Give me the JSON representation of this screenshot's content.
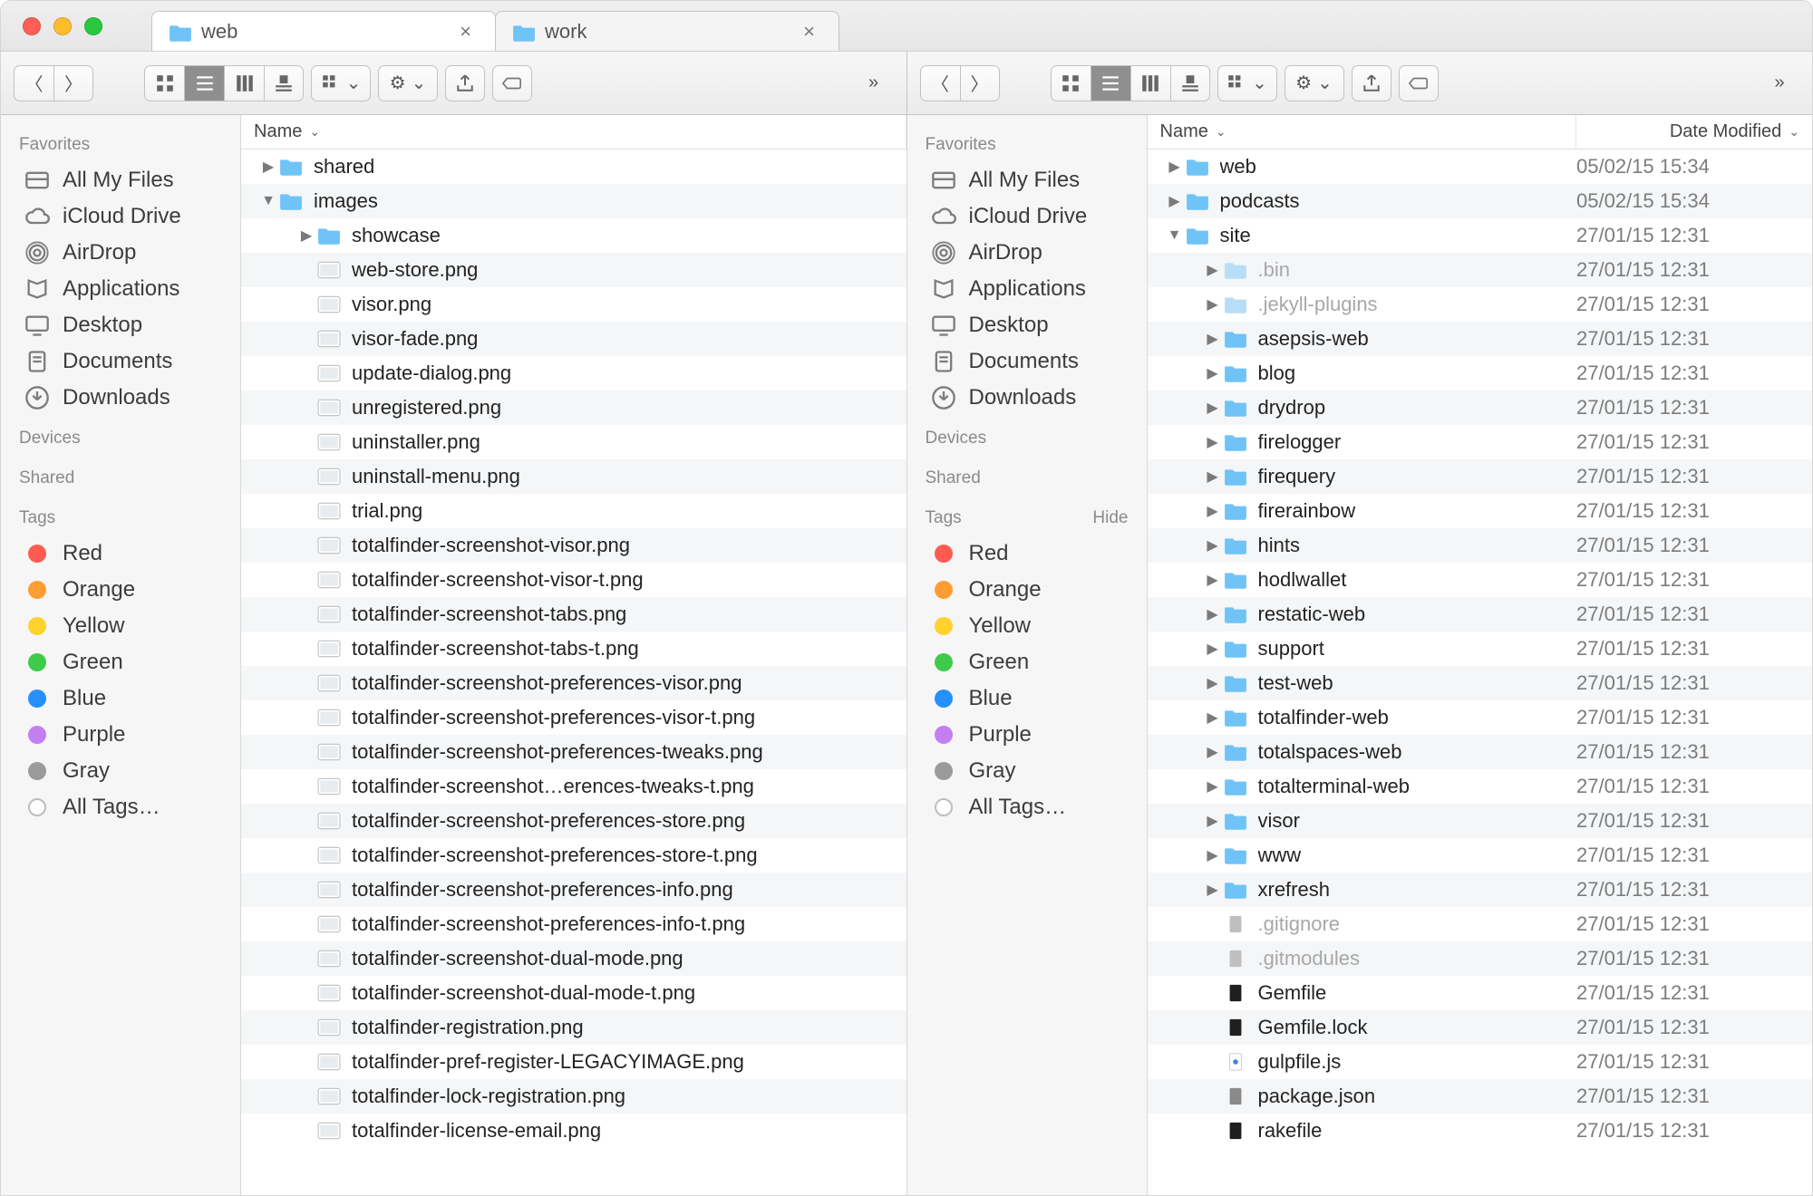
{
  "tabs": [
    {
      "title": "web",
      "active": true
    },
    {
      "title": "work",
      "active": false
    }
  ],
  "columns": {
    "name": "Name",
    "date": "Date Modified"
  },
  "sidebar": {
    "sections": [
      {
        "title": "Favorites",
        "items": [
          {
            "icon": "allmyfiles",
            "label": "All My Files"
          },
          {
            "icon": "cloud",
            "label": "iCloud Drive"
          },
          {
            "icon": "airdrop",
            "label": "AirDrop"
          },
          {
            "icon": "apps",
            "label": "Applications"
          },
          {
            "icon": "desktop",
            "label": "Desktop"
          },
          {
            "icon": "docs",
            "label": "Documents"
          },
          {
            "icon": "downloads",
            "label": "Downloads"
          }
        ]
      },
      {
        "title": "Devices",
        "items": []
      },
      {
        "title": "Shared",
        "items": []
      },
      {
        "title": "Tags",
        "hide_visible_on_right": true,
        "items": [
          {
            "icon": "tag",
            "color": "#ff5b52",
            "label": "Red"
          },
          {
            "icon": "tag",
            "color": "#ff9d32",
            "label": "Orange"
          },
          {
            "icon": "tag",
            "color": "#ffd22e",
            "label": "Yellow"
          },
          {
            "icon": "tag",
            "color": "#3ecb4b",
            "label": "Green"
          },
          {
            "icon": "tag",
            "color": "#2690ff",
            "label": "Blue"
          },
          {
            "icon": "tag",
            "color": "#c37ff2",
            "label": "Purple"
          },
          {
            "icon": "tag",
            "color": "#9b9b9b",
            "label": "Gray"
          },
          {
            "icon": "tag",
            "color": "",
            "label": "All Tags…"
          }
        ]
      }
    ],
    "hide_label": "Hide"
  },
  "left": {
    "has_date": false,
    "rows": [
      {
        "depth": 0,
        "disclose": "right",
        "kind": "folder",
        "name": "shared"
      },
      {
        "depth": 0,
        "disclose": "down",
        "kind": "folder",
        "name": "images"
      },
      {
        "depth": 1,
        "disclose": "right",
        "kind": "folder",
        "name": "showcase"
      },
      {
        "depth": 1,
        "disclose": "",
        "kind": "png",
        "name": "web-store.png"
      },
      {
        "depth": 1,
        "disclose": "",
        "kind": "png",
        "name": "visor.png"
      },
      {
        "depth": 1,
        "disclose": "",
        "kind": "png",
        "name": "visor-fade.png"
      },
      {
        "depth": 1,
        "disclose": "",
        "kind": "png",
        "name": "update-dialog.png"
      },
      {
        "depth": 1,
        "disclose": "",
        "kind": "png",
        "name": "unregistered.png"
      },
      {
        "depth": 1,
        "disclose": "",
        "kind": "png",
        "name": "uninstaller.png"
      },
      {
        "depth": 1,
        "disclose": "",
        "kind": "png",
        "name": "uninstall-menu.png"
      },
      {
        "depth": 1,
        "disclose": "",
        "kind": "png",
        "name": "trial.png"
      },
      {
        "depth": 1,
        "disclose": "",
        "kind": "png",
        "name": "totalfinder-screenshot-visor.png"
      },
      {
        "depth": 1,
        "disclose": "",
        "kind": "png",
        "name": "totalfinder-screenshot-visor-t.png"
      },
      {
        "depth": 1,
        "disclose": "",
        "kind": "png",
        "name": "totalfinder-screenshot-tabs.png"
      },
      {
        "depth": 1,
        "disclose": "",
        "kind": "png",
        "name": "totalfinder-screenshot-tabs-t.png"
      },
      {
        "depth": 1,
        "disclose": "",
        "kind": "png",
        "name": "totalfinder-screenshot-preferences-visor.png"
      },
      {
        "depth": 1,
        "disclose": "",
        "kind": "png",
        "name": "totalfinder-screenshot-preferences-visor-t.png"
      },
      {
        "depth": 1,
        "disclose": "",
        "kind": "png",
        "name": "totalfinder-screenshot-preferences-tweaks.png"
      },
      {
        "depth": 1,
        "disclose": "",
        "kind": "png",
        "name": "totalfinder-screenshot…erences-tweaks-t.png"
      },
      {
        "depth": 1,
        "disclose": "",
        "kind": "png",
        "name": "totalfinder-screenshot-preferences-store.png"
      },
      {
        "depth": 1,
        "disclose": "",
        "kind": "png",
        "name": "totalfinder-screenshot-preferences-store-t.png"
      },
      {
        "depth": 1,
        "disclose": "",
        "kind": "png",
        "name": "totalfinder-screenshot-preferences-info.png"
      },
      {
        "depth": 1,
        "disclose": "",
        "kind": "png",
        "name": "totalfinder-screenshot-preferences-info-t.png"
      },
      {
        "depth": 1,
        "disclose": "",
        "kind": "png",
        "name": "totalfinder-screenshot-dual-mode.png"
      },
      {
        "depth": 1,
        "disclose": "",
        "kind": "png",
        "name": "totalfinder-screenshot-dual-mode-t.png"
      },
      {
        "depth": 1,
        "disclose": "",
        "kind": "png",
        "name": "totalfinder-registration.png"
      },
      {
        "depth": 1,
        "disclose": "",
        "kind": "png",
        "name": "totalfinder-pref-register-LEGACYIMAGE.png"
      },
      {
        "depth": 1,
        "disclose": "",
        "kind": "png",
        "name": "totalfinder-lock-registration.png"
      },
      {
        "depth": 1,
        "disclose": "",
        "kind": "png",
        "name": "totalfinder-license-email.png"
      }
    ]
  },
  "right": {
    "has_date": true,
    "rows": [
      {
        "depth": 0,
        "disclose": "right",
        "kind": "folder",
        "name": "web",
        "date": "05/02/15 15:34"
      },
      {
        "depth": 0,
        "disclose": "right",
        "kind": "folder",
        "name": "podcasts",
        "date": "05/02/15 15:34"
      },
      {
        "depth": 0,
        "disclose": "down",
        "kind": "folder",
        "name": "site",
        "date": "27/01/15 12:31"
      },
      {
        "depth": 1,
        "disclose": "right",
        "kind": "folder",
        "name": ".bin",
        "date": "27/01/15 12:31",
        "dim": true
      },
      {
        "depth": 1,
        "disclose": "right",
        "kind": "folder",
        "name": ".jekyll-plugins",
        "date": "27/01/15 12:31",
        "dim": true
      },
      {
        "depth": 1,
        "disclose": "right",
        "kind": "folder",
        "name": "asepsis-web",
        "date": "27/01/15 12:31"
      },
      {
        "depth": 1,
        "disclose": "right",
        "kind": "folder",
        "name": "blog",
        "date": "27/01/15 12:31"
      },
      {
        "depth": 1,
        "disclose": "right",
        "kind": "folder",
        "name": "drydrop",
        "date": "27/01/15 12:31"
      },
      {
        "depth": 1,
        "disclose": "right",
        "kind": "folder",
        "name": "firelogger",
        "date": "27/01/15 12:31"
      },
      {
        "depth": 1,
        "disclose": "right",
        "kind": "folder",
        "name": "firequery",
        "date": "27/01/15 12:31"
      },
      {
        "depth": 1,
        "disclose": "right",
        "kind": "folder",
        "name": "firerainbow",
        "date": "27/01/15 12:31"
      },
      {
        "depth": 1,
        "disclose": "right",
        "kind": "folder",
        "name": "hints",
        "date": "27/01/15 12:31"
      },
      {
        "depth": 1,
        "disclose": "right",
        "kind": "folder",
        "name": "hodlwallet",
        "date": "27/01/15 12:31"
      },
      {
        "depth": 1,
        "disclose": "right",
        "kind": "folder",
        "name": "restatic-web",
        "date": "27/01/15 12:31"
      },
      {
        "depth": 1,
        "disclose": "right",
        "kind": "folder",
        "name": "support",
        "date": "27/01/15 12:31"
      },
      {
        "depth": 1,
        "disclose": "right",
        "kind": "folder",
        "name": "test-web",
        "date": "27/01/15 12:31"
      },
      {
        "depth": 1,
        "disclose": "right",
        "kind": "folder",
        "name": "totalfinder-web",
        "date": "27/01/15 12:31"
      },
      {
        "depth": 1,
        "disclose": "right",
        "kind": "folder",
        "name": "totalspaces-web",
        "date": "27/01/15 12:31"
      },
      {
        "depth": 1,
        "disclose": "right",
        "kind": "folder",
        "name": "totalterminal-web",
        "date": "27/01/15 12:31"
      },
      {
        "depth": 1,
        "disclose": "right",
        "kind": "folder",
        "name": "visor",
        "date": "27/01/15 12:31"
      },
      {
        "depth": 1,
        "disclose": "right",
        "kind": "folder",
        "name": "www",
        "date": "27/01/15 12:31"
      },
      {
        "depth": 1,
        "disclose": "right",
        "kind": "folder",
        "name": "xrefresh",
        "date": "27/01/15 12:31"
      },
      {
        "depth": 1,
        "disclose": "",
        "kind": "file",
        "name": ".gitignore",
        "date": "27/01/15 12:31",
        "dim": true
      },
      {
        "depth": 1,
        "disclose": "",
        "kind": "file",
        "name": ".gitmodules",
        "date": "27/01/15 12:31",
        "dim": true
      },
      {
        "depth": 1,
        "disclose": "",
        "kind": "exec",
        "name": "Gemfile",
        "date": "27/01/15 12:31"
      },
      {
        "depth": 1,
        "disclose": "",
        "kind": "exec",
        "name": "Gemfile.lock",
        "date": "27/01/15 12:31"
      },
      {
        "depth": 1,
        "disclose": "",
        "kind": "js",
        "name": "gulpfile.js",
        "date": "27/01/15 12:31"
      },
      {
        "depth": 1,
        "disclose": "",
        "kind": "file",
        "name": "package.json",
        "date": "27/01/15 12:31"
      },
      {
        "depth": 1,
        "disclose": "",
        "kind": "exec",
        "name": "rakefile",
        "date": "27/01/15 12:31"
      }
    ]
  }
}
